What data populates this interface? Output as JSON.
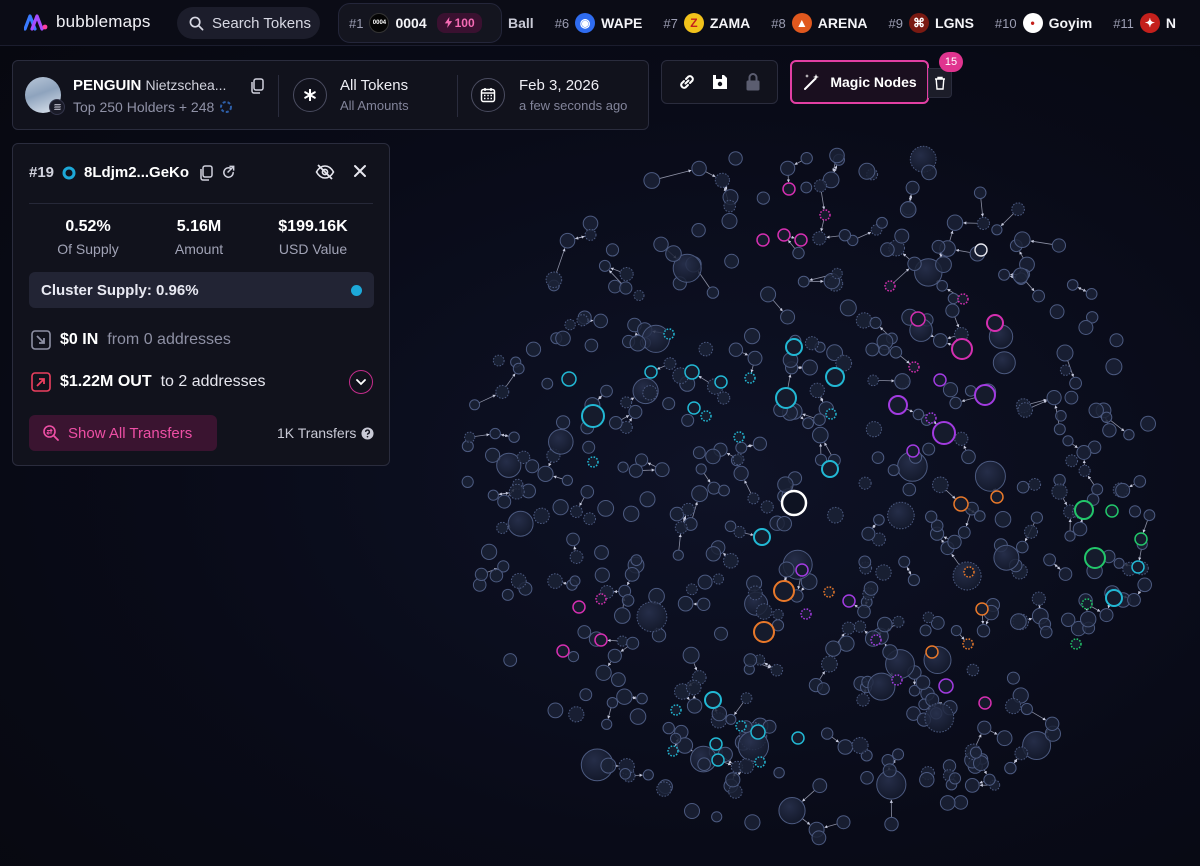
{
  "app": {
    "name": "bubblemaps"
  },
  "search": {
    "placeholder": "Search Tokens"
  },
  "ticker": {
    "first": {
      "rank": "#1",
      "name": "0004",
      "logo_text": "0004",
      "boost": "100"
    },
    "partial": "Ball",
    "items": [
      {
        "rank": "#6",
        "name": "WAPE",
        "logo_color": "#2f6cf0",
        "logo_char": "◉"
      },
      {
        "rank": "#7",
        "name": "ZAMA",
        "logo_color": "#f2c21b",
        "logo_char": "Z"
      },
      {
        "rank": "#8",
        "name": "ARENA",
        "logo_color": "#e0581e",
        "logo_char": "▲"
      },
      {
        "rank": "#9",
        "name": "LGNS",
        "logo_color": "#7a1a12",
        "logo_char": "⌘"
      },
      {
        "rank": "#10",
        "name": "Goyim",
        "logo_color": "#ffffff",
        "logo_char": "•"
      },
      {
        "rank": "#11",
        "name": "N",
        "logo_color": "#c4201c",
        "logo_char": "✦"
      }
    ]
  },
  "token": {
    "symbol": "PENGUIN",
    "name": "Nietzschea...",
    "subtitle": "Top 250 Holders + 248"
  },
  "filter": {
    "title": "All Tokens",
    "subtitle": "All Amounts"
  },
  "date": {
    "title": "Feb 3, 2026",
    "subtitle": "a few seconds ago"
  },
  "magic": {
    "label": "Magic Nodes",
    "count": "15"
  },
  "holder": {
    "rank": "#19",
    "address": "8Ldjm2...GeKo",
    "stats": [
      {
        "value": "0.52%",
        "label": "Of Supply"
      },
      {
        "value": "5.16M",
        "label": "Amount"
      },
      {
        "value": "$199.16K",
        "label": "USD Value"
      }
    ],
    "cluster": "Cluster Supply: 0.96%",
    "in": {
      "amount": "$0 IN",
      "text": "from 0 addresses"
    },
    "out": {
      "amount": "$1.22M OUT",
      "text": "to 2 addresses"
    },
    "show_all": "Show All Transfers",
    "transfers": "1K Transfers"
  },
  "colors": {
    "accent": "#e23fa3",
    "cyan": "#22b8d4",
    "magenta": "#d42fb0",
    "purple": "#a23be0",
    "orange": "#e8782a",
    "green": "#22c66a",
    "node": "#1b2236",
    "node_stroke": "#4c5a80"
  }
}
